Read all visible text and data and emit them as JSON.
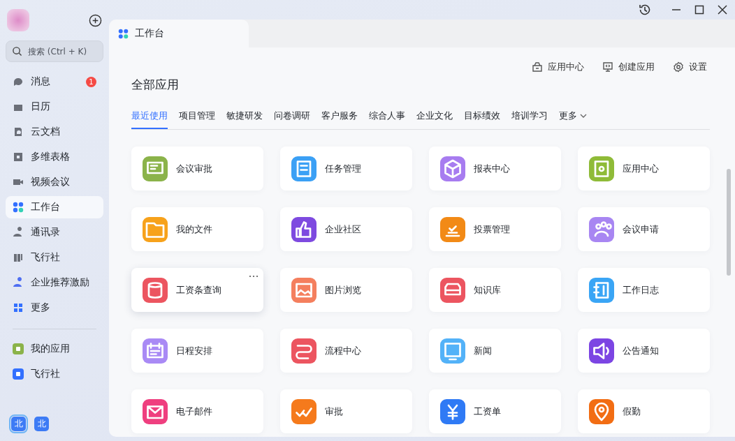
{
  "sidebar": {
    "search": {
      "placeholder": "搜索 (Ctrl + K)"
    },
    "items": [
      {
        "label": "消息",
        "selected": false,
        "badge": "1"
      },
      {
        "label": "日历",
        "selected": false
      },
      {
        "label": "云文档",
        "selected": false
      },
      {
        "label": "多维表格",
        "selected": false
      },
      {
        "label": "视频会议",
        "selected": false
      },
      {
        "label": "工作台",
        "selected": true
      },
      {
        "label": "通讯录",
        "selected": false
      },
      {
        "label": "飞行社",
        "selected": false
      },
      {
        "label": "企业推荐激励",
        "selected": false
      },
      {
        "label": "更多",
        "selected": false
      }
    ],
    "pinned": [
      {
        "label": "我的应用",
        "selected": false
      },
      {
        "label": "飞行社",
        "selected": false
      }
    ],
    "accounts": [
      {
        "label": "北",
        "selected": true
      },
      {
        "label": "北",
        "selected": false
      }
    ]
  },
  "tab": {
    "label": "工作台"
  },
  "toolbar": [
    "应用中心",
    "创建应用",
    "设置"
  ],
  "title": "全部应用",
  "categories": [
    {
      "label": "最近使用",
      "selected": true
    },
    {
      "label": "项目管理",
      "selected": false
    },
    {
      "label": "敏捷研发",
      "selected": false
    },
    {
      "label": "问卷调研",
      "selected": false
    },
    {
      "label": "客户服务",
      "selected": false
    },
    {
      "label": "综合人事",
      "selected": false
    },
    {
      "label": "企业文化",
      "selected": false
    },
    {
      "label": "目标绩效",
      "selected": false
    },
    {
      "label": "培训学习",
      "selected": false
    },
    {
      "label": "更多",
      "selected": false
    }
  ],
  "apps": [
    {
      "label": "会议审批",
      "color": "#8bb34a",
      "hovered": false
    },
    {
      "label": "任务管理",
      "color": "#3ba0f5",
      "hovered": false
    },
    {
      "label": "报表中心",
      "color": "#a77cf0",
      "hovered": false
    },
    {
      "label": "应用中心",
      "color": "#8fbb38",
      "hovered": false
    },
    {
      "label": "我的文件",
      "color": "#f7a21b",
      "hovered": false
    },
    {
      "label": "企业社区",
      "color": "#7e4ae0",
      "hovered": false
    },
    {
      "label": "投票管理",
      "color": "#f28a16",
      "hovered": false
    },
    {
      "label": "会议申请",
      "color": "#a886f2",
      "hovered": false
    },
    {
      "label": "工资条查询",
      "color": "#ec5560",
      "hovered": true
    },
    {
      "label": "图片浏览",
      "color": "#f47f5e",
      "hovered": false
    },
    {
      "label": "知识库",
      "color": "#ec5560",
      "hovered": false
    },
    {
      "label": "工作日志",
      "color": "#3aa5f5",
      "hovered": false
    },
    {
      "label": "日程安排",
      "color": "#a98af5",
      "hovered": false
    },
    {
      "label": "流程中心",
      "color": "#ec5560",
      "hovered": false
    },
    {
      "label": "新闻",
      "color": "#53b2f8",
      "hovered": false
    },
    {
      "label": "公告通知",
      "color": "#7c45e3",
      "hovered": false
    },
    {
      "label": "电子邮件",
      "color": "#ef3f7f",
      "hovered": false
    },
    {
      "label": "审批",
      "color": "#f57a1c",
      "hovered": false
    },
    {
      "label": "工资单",
      "color": "#2f7af5",
      "hovered": false
    },
    {
      "label": "假勤",
      "color": "#f26d13",
      "hovered": false
    }
  ]
}
